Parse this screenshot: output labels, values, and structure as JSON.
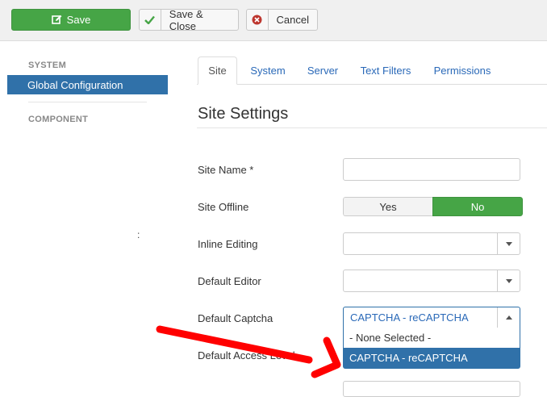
{
  "toolbar": {
    "save_label": "Save",
    "save_close_label": "Save & Close",
    "cancel_label": "Cancel"
  },
  "sidebar": {
    "system_heading": "SYSTEM",
    "active_item": "Global Configuration",
    "component_heading": "COMPONENT",
    "stray_text": ":"
  },
  "tabs": [
    "Site",
    "System",
    "Server",
    "Text Filters",
    "Permissions"
  ],
  "section": {
    "title": "Site Settings"
  },
  "form": {
    "site_name_label": "Site Name *",
    "site_name_value": "",
    "site_offline_label": "Site Offline",
    "site_offline_yes": "Yes",
    "site_offline_no": "No",
    "inline_editing_label": "Inline Editing",
    "inline_editing_value": "",
    "default_editor_label": "Default Editor",
    "default_editor_value": "",
    "default_captcha_label": "Default Captcha",
    "default_captcha_value": "CAPTCHA - reCAPTCHA",
    "captcha_options": [
      "- None Selected -",
      "CAPTCHA - reCAPTCHA"
    ],
    "default_access_label": "Default Access Level"
  },
  "colors": {
    "save_green": "#46a546",
    "selection_blue": "#3071a9",
    "link_blue": "#2a69b8",
    "annotation_red": "#ff0000"
  }
}
